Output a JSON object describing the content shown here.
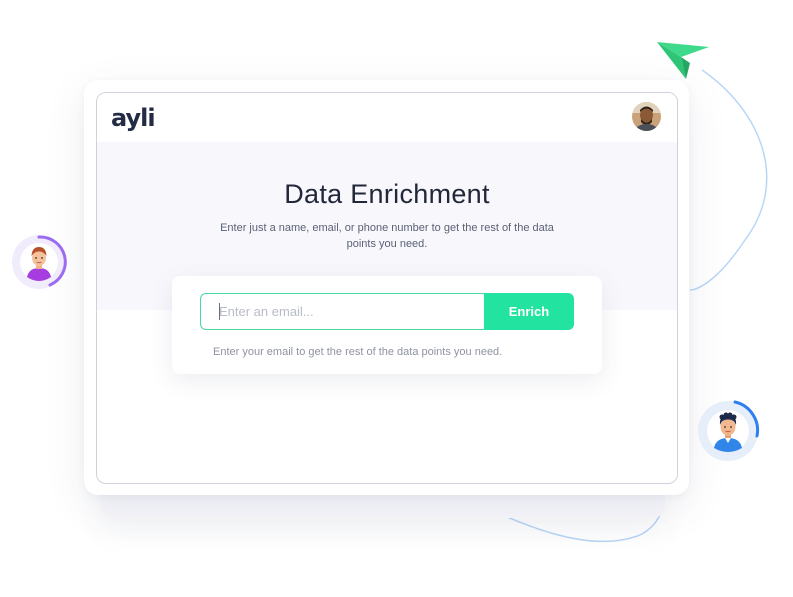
{
  "app": {
    "logo_text": "ayli"
  },
  "header": {
    "profile_avatar": "user-profile-avatar"
  },
  "hero": {
    "title": "Data Enrichment",
    "subtitle": "Enter just a name, email, or phone number to get the rest of the data points you need."
  },
  "form": {
    "email_placeholder": "Enter an email...",
    "email_value": "",
    "submit_label": "Enrich",
    "hint": "Enter your email to get the rest of the data points you need."
  },
  "decorations": {
    "icons": [
      "paper-plane-icon",
      "user-avatar-left",
      "user-avatar-right"
    ]
  },
  "colors": {
    "accent": "#23e3a1",
    "input_border": "#48d9a0",
    "title": "#22283a",
    "ring_left": "#9b6cf2",
    "ring_right": "#2f7ff0",
    "paper_plane": "#3ed98a",
    "path_line": "#b9d6f7"
  }
}
